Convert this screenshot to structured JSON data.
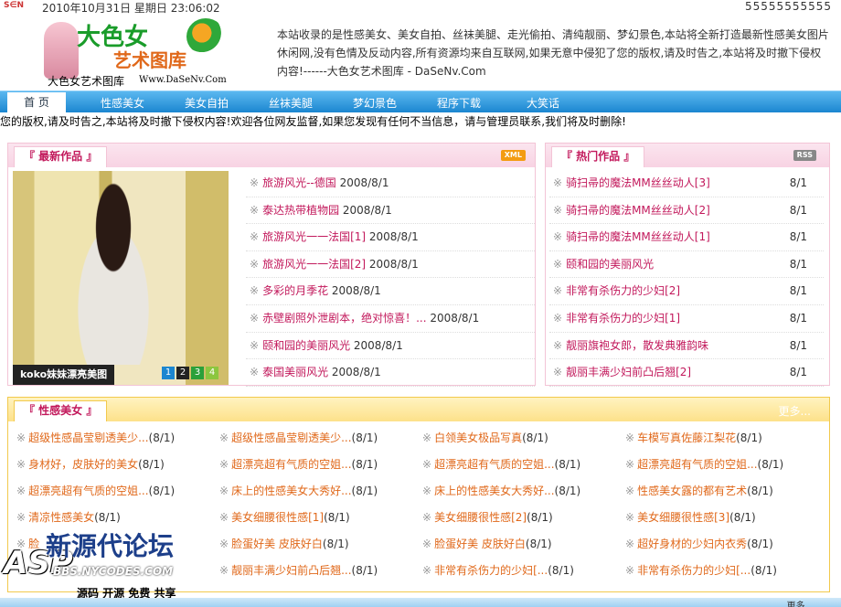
{
  "top": {
    "logo_small": "S∈N",
    "datetime": "2010年10月31日 星期日 23:06:02",
    "phone": "55555555555"
  },
  "logo": {
    "title": "大色女",
    "subtitle": "艺术图库",
    "site_name": "大色女艺术图库",
    "site_url": "Www.DaSeNv.Com"
  },
  "intro": "本站收录的是性感美女、美女自拍、丝袜美腿、走光偷拍、清纯靓丽、梦幻景色,本站将全新打造最新性感美女图片休闲网,没有色情及反动内容,所有资源均来自互联网,如果无意中侵犯了您的版权,请及时告之,本站将及时撤下侵权内容!------大色女艺术图库 - DaSeNv.Com",
  "nav": {
    "home": "首 页",
    "items": [
      "性感美女",
      "美女自拍",
      "丝袜美腿",
      "梦幻景色",
      "程序下载",
      "大笑话"
    ]
  },
  "ticker": "您的版权,请及时告之,本站将及时撤下侵权内容!欢迎各位网友监督,如果您发现有任何不当信息，请与管理员联系,我们将及时删除!",
  "latest": {
    "title": "『 最新作品 』",
    "badge": "XML",
    "photo_caption": "koko妹妹漂亮美图",
    "pages": [
      "1",
      "2",
      "3",
      "4"
    ],
    "items": [
      {
        "title": "旅游风光--德国",
        "date": "2008/8/1"
      },
      {
        "title": "泰达热带植物园",
        "date": "2008/8/1"
      },
      {
        "title": "旅游风光一一法国[1]",
        "date": "2008/8/1"
      },
      {
        "title": "旅游风光一一法国[2]",
        "date": "2008/8/1"
      },
      {
        "title": "多彩的月季花",
        "date": "2008/8/1"
      },
      {
        "title": "赤壁剧照外泄剧本，绝对惊喜！...",
        "date": "2008/8/1"
      },
      {
        "title": "颐和园的美丽风光",
        "date": "2008/8/1"
      },
      {
        "title": "泰国美丽风光",
        "date": "2008/8/1"
      }
    ]
  },
  "hot": {
    "title": "『 热门作品 』",
    "badge": "RSS",
    "items": [
      {
        "title": "骑扫帚的魔法MM丝丝动人[3]",
        "date": "8/1"
      },
      {
        "title": "骑扫帚的魔法MM丝丝动人[2]",
        "date": "8/1"
      },
      {
        "title": "骑扫帚的魔法MM丝丝动人[1]",
        "date": "8/1"
      },
      {
        "title": "颐和园的美丽风光",
        "date": "8/1"
      },
      {
        "title": "非常有杀伤力的少妇[2]",
        "date": "8/1"
      },
      {
        "title": "非常有杀伤力的少妇[1]",
        "date": "8/1"
      },
      {
        "title": "靓丽旗袍女郎，散发典雅韵味",
        "date": "8/1"
      },
      {
        "title": "靓丽丰满少妇前凸后翘[2]",
        "date": "8/1"
      }
    ]
  },
  "sexy": {
    "title": "『 性感美女 』",
    "more": "更多...",
    "rows": [
      [
        {
          "title": "超级性感晶莹剔透美少...",
          "date": "(8/1)"
        },
        {
          "title": "超级性感晶莹剔透美少...",
          "date": "(8/1)"
        },
        {
          "title": "白领美女极品写真",
          "date": "(8/1)"
        },
        {
          "title": "车模写真佐藤江梨花",
          "date": "(8/1)"
        }
      ],
      [
        {
          "title": "身材好，皮肤好的美女",
          "date": "(8/1)"
        },
        {
          "title": "超漂亮超有气质的空姐...",
          "date": "(8/1)"
        },
        {
          "title": "超漂亮超有气质的空姐...",
          "date": "(8/1)"
        },
        {
          "title": "超漂亮超有气质的空姐...",
          "date": "(8/1)"
        }
      ],
      [
        {
          "title": "超漂亮超有气质的空姐...",
          "date": "(8/1)"
        },
        {
          "title": "床上的性感美女大秀好...",
          "date": "(8/1)"
        },
        {
          "title": "床上的性感美女大秀好...",
          "date": "(8/1)"
        },
        {
          "title": "性感美女露的都有艺术",
          "date": "(8/1)"
        }
      ],
      [
        {
          "title": "清凉性感美女",
          "date": "(8/1)"
        },
        {
          "title": "美女细腰很性感[1]",
          "date": "(8/1)"
        },
        {
          "title": "美女细腰很性感[2]",
          "date": "(8/1)"
        },
        {
          "title": "美女细腰很性感[3]",
          "date": "(8/1)"
        }
      ],
      [
        {
          "title": "脸",
          "date": ""
        },
        {
          "title": "脸蛋好美 皮肤好白",
          "date": "(8/1)"
        },
        {
          "title": "脸蛋好美 皮肤好白",
          "date": "(8/1)"
        },
        {
          "title": "超好身材的少妇内衣秀",
          "date": "(8/1)"
        }
      ],
      [
        {
          "title": "",
          "date": ""
        },
        {
          "title": "靓丽丰满少妇前凸后翘...",
          "date": "(8/1)"
        },
        {
          "title": "非常有杀伤力的少妇[...",
          "date": "(8/1)"
        },
        {
          "title": "非常有杀伤力的少妇[...",
          "date": "(8/1)"
        }
      ]
    ]
  },
  "watermark": {
    "asp": "ASP",
    "cn": "新源代论坛",
    "url": "BBS.NYCODES.COM",
    "tag": "源码 开源 免费 共享"
  },
  "bottom_more": "更多..."
}
